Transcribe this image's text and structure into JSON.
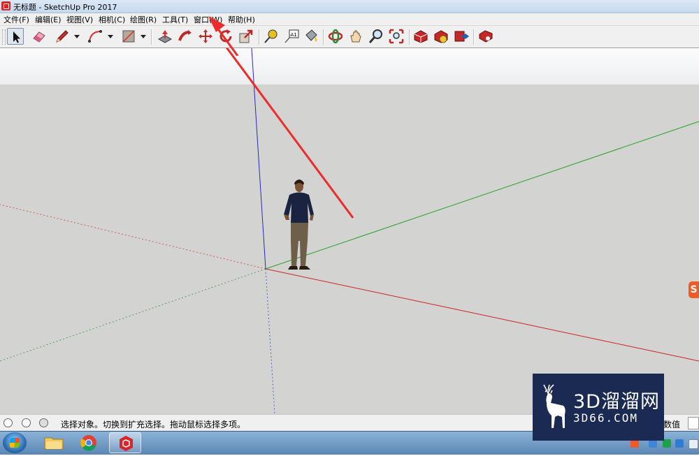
{
  "window": {
    "title": "无标题 - SketchUp Pro 2017"
  },
  "menu": [
    "文件(F)",
    "编辑(E)",
    "视图(V)",
    "相机(C)",
    "绘图(R)",
    "工具(T)",
    "窗口(W)",
    "帮助(H)"
  ],
  "toolbar": {
    "tools": [
      "select-tool",
      "eraser-tool",
      "pencil-line-tool",
      "arc-tool",
      "rectangle-tool",
      "push-pull-tool",
      "follow-me-tool",
      "move-tool",
      "rotate-tool",
      "scale-tool",
      "tape-measure-tool",
      "text-tool",
      "paint-bucket-tool",
      "orbit-tool",
      "pan-tool",
      "zoom-tool",
      "zoom-extents-tool",
      "3d-warehouse-tool",
      "extension-warehouse-tool",
      "share-model-tool",
      "extension-manager-tool"
    ],
    "text_tool_label": "A1"
  },
  "status": {
    "text": "选择对象。切换到扩充选择。拖动鼠标选择多项。",
    "measurements_label": "数值"
  },
  "watermark": {
    "title": "3D溜溜网",
    "url": "3D66.COM"
  },
  "side_badge": "S",
  "colors": {
    "sky": "#f2f3f4",
    "ground": "#d3d3d1",
    "red_axis": "#d02020",
    "green_axis": "#20a020",
    "blue_axis": "#2828c8",
    "annotation_arrow": "#ee2b2b"
  }
}
